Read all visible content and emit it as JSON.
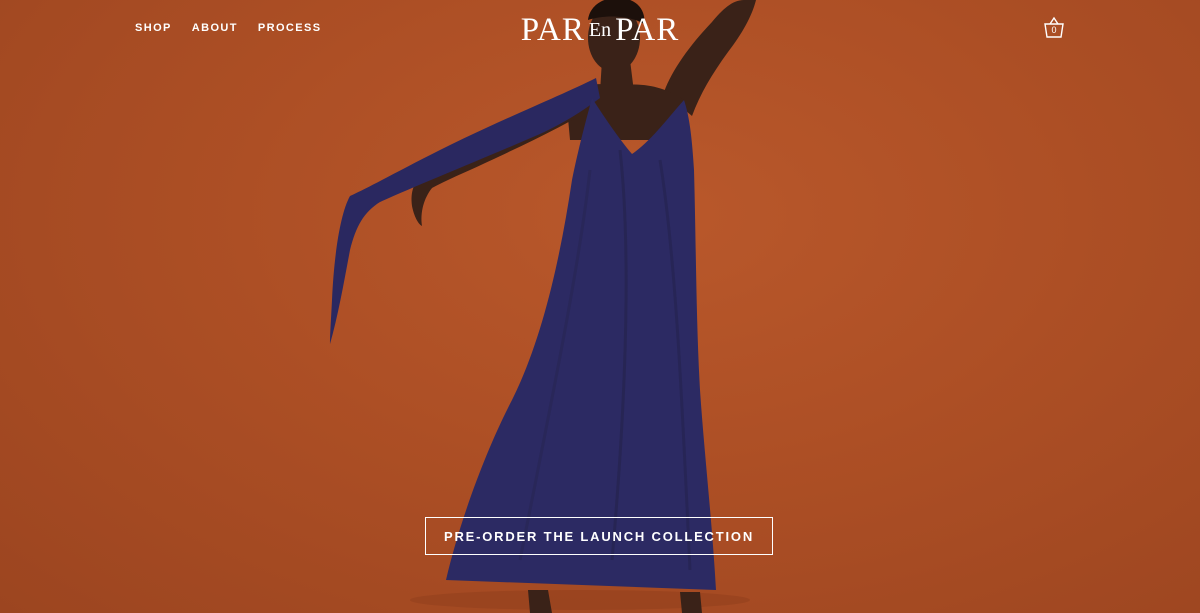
{
  "nav": {
    "items": [
      {
        "label": "SHOP"
      },
      {
        "label": "ABOUT"
      },
      {
        "label": "PROCESS"
      }
    ]
  },
  "logo": {
    "part1": "PAR",
    "part2": "En",
    "part3": "PAR"
  },
  "cart": {
    "icon": "shopping-basket-icon",
    "count": "0"
  },
  "hero": {
    "background_color": "#ad4f25",
    "dress_color": "#2c2a63",
    "cta_label": "PRE-ORDER THE LAUNCH COLLECTION"
  }
}
